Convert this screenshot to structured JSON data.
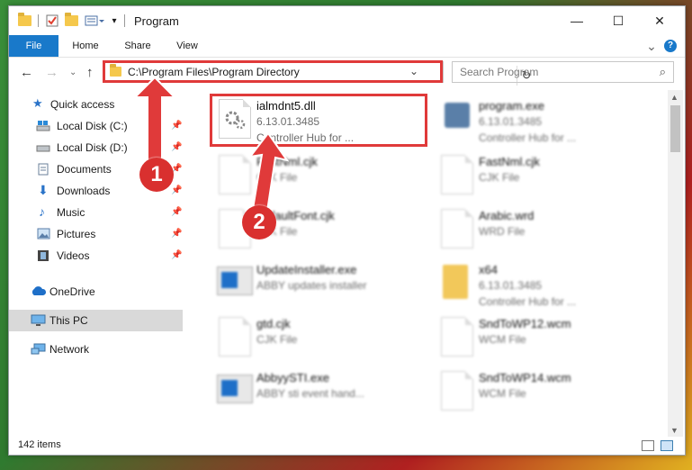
{
  "window": {
    "title": "Program"
  },
  "titlebar": {
    "minimize": "—",
    "maximize": "☐",
    "close": "✕"
  },
  "ribbon": {
    "tabs": [
      "File",
      "Home",
      "Share",
      "View"
    ],
    "expand": "⌄",
    "help": "?"
  },
  "address": {
    "path": "C:\\Program Files\\Program Directory",
    "search_placeholder": "Search Program"
  },
  "nav": {
    "items": [
      {
        "label": "Quick access"
      },
      {
        "label": "Local Disk (C:)"
      },
      {
        "label": "Local Disk (D:)"
      },
      {
        "label": "Documents"
      },
      {
        "label": "Downloads"
      },
      {
        "label": "Music"
      },
      {
        "label": "Pictures"
      },
      {
        "label": "Videos"
      },
      {
        "label": "OneDrive"
      },
      {
        "label": "This PC"
      },
      {
        "label": "Network"
      }
    ]
  },
  "files": [
    {
      "name": "ialmdnt5.dll",
      "line1": "6.13.01.3485",
      "line2": "Controller Hub for ..."
    },
    {
      "name": "program.exe",
      "line1": "6.13.01.3485",
      "line2": "Controller Hub for ..."
    },
    {
      "name": "FastNml.cjk",
      "line1": "CJK File",
      "line2": ""
    },
    {
      "name": "FastNml.cjk",
      "line1": "CJK File",
      "line2": ""
    },
    {
      "name": "DefaultFont.cjk",
      "line1": "CJK File",
      "line2": ""
    },
    {
      "name": "Arabic.wrd",
      "line1": "WRD File",
      "line2": ""
    },
    {
      "name": "UpdateInstaller.exe",
      "line1": "ABBY updates installer",
      "line2": ""
    },
    {
      "name": "x64",
      "line1": "6.13.01.3485",
      "line2": "Controller Hub for ..."
    },
    {
      "name": "gtd.cjk",
      "line1": "CJK File",
      "line2": ""
    },
    {
      "name": "SndToWP12.wcm",
      "line1": "WCM File",
      "line2": ""
    },
    {
      "name": "AbbyySTI.exe",
      "line1": "ABBY sti event hand...",
      "line2": ""
    },
    {
      "name": "SndToWP14.wcm",
      "line1": "WCM File",
      "line2": ""
    }
  ],
  "status": {
    "items_count": "142 items"
  },
  "annotations": {
    "badge1": "1",
    "badge2": "2"
  },
  "colors": {
    "accent": "#1979ca",
    "highlight": "#e03a3a",
    "selected_nav": "#d9d9d9"
  }
}
